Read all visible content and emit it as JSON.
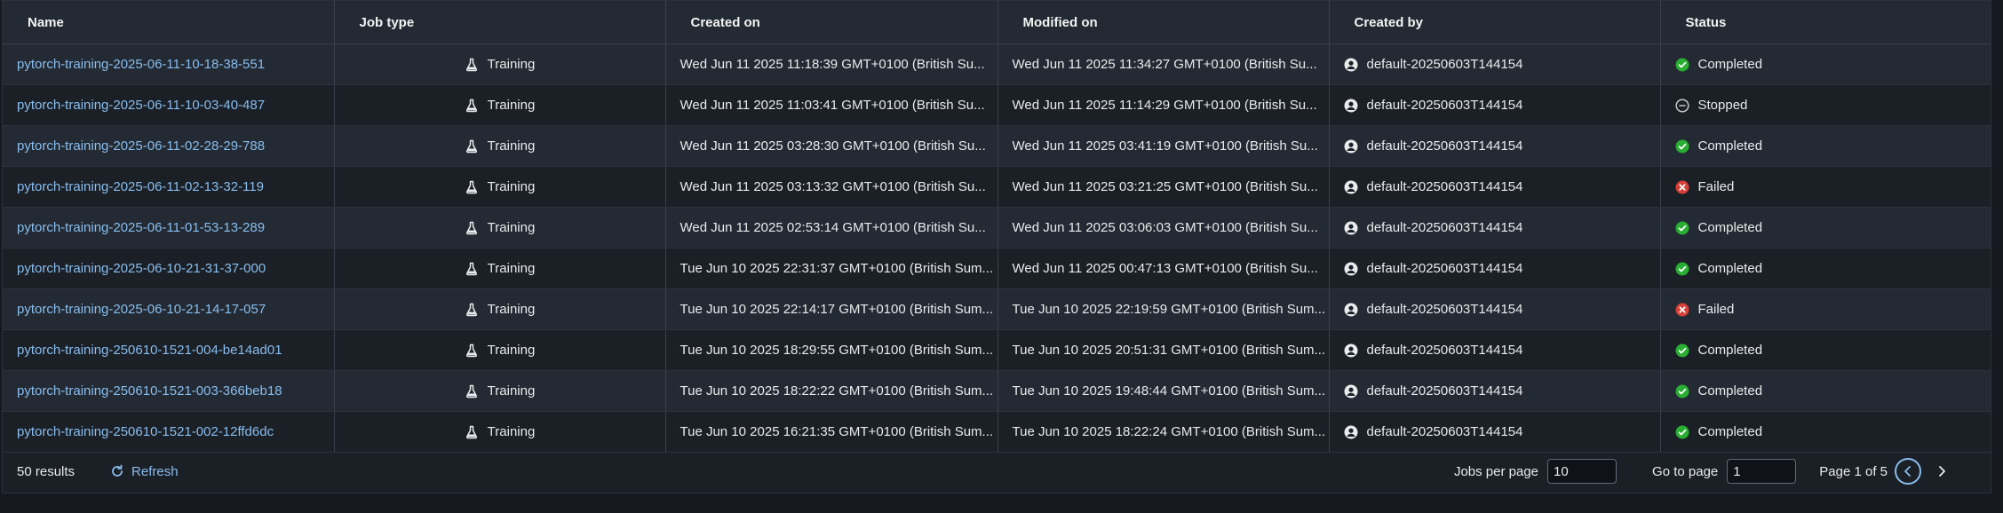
{
  "columns": [
    "Name",
    "Job type",
    "Created on",
    "Modified on",
    "Created by",
    "Status"
  ],
  "rows": [
    {
      "name": "pytorch-training-2025-06-11-10-18-38-551",
      "type": "Training",
      "created": "Wed Jun 11 2025 11:18:39 GMT+0100 (British Su...",
      "modified": "Wed Jun 11 2025 11:34:27 GMT+0100 (British Su...",
      "by": "default-20250603T144154",
      "status": "Completed",
      "status_icon": "completed-icon"
    },
    {
      "name": "pytorch-training-2025-06-11-10-03-40-487",
      "type": "Training",
      "created": "Wed Jun 11 2025 11:03:41 GMT+0100 (British Su...",
      "modified": "Wed Jun 11 2025 11:14:29 GMT+0100 (British Su...",
      "by": "default-20250603T144154",
      "status": "Stopped",
      "status_icon": "stopped-icon"
    },
    {
      "name": "pytorch-training-2025-06-11-02-28-29-788",
      "type": "Training",
      "created": "Wed Jun 11 2025 03:28:30 GMT+0100 (British Su...",
      "modified": "Wed Jun 11 2025 03:41:19 GMT+0100 (British Su...",
      "by": "default-20250603T144154",
      "status": "Completed",
      "status_icon": "completed-icon"
    },
    {
      "name": "pytorch-training-2025-06-11-02-13-32-119",
      "type": "Training",
      "created": "Wed Jun 11 2025 03:13:32 GMT+0100 (British Su...",
      "modified": "Wed Jun 11 2025 03:21:25 GMT+0100 (British Su...",
      "by": "default-20250603T144154",
      "status": "Failed",
      "status_icon": "failed-icon"
    },
    {
      "name": "pytorch-training-2025-06-11-01-53-13-289",
      "type": "Training",
      "created": "Wed Jun 11 2025 02:53:14 GMT+0100 (British Su...",
      "modified": "Wed Jun 11 2025 03:06:03 GMT+0100 (British Su...",
      "by": "default-20250603T144154",
      "status": "Completed",
      "status_icon": "completed-icon"
    },
    {
      "name": "pytorch-training-2025-06-10-21-31-37-000",
      "type": "Training",
      "created": "Tue Jun 10 2025 22:31:37 GMT+0100 (British Sum...",
      "modified": "Wed Jun 11 2025 00:47:13 GMT+0100 (British Su...",
      "by": "default-20250603T144154",
      "status": "Completed",
      "status_icon": "completed-icon"
    },
    {
      "name": "pytorch-training-2025-06-10-21-14-17-057",
      "type": "Training",
      "created": "Tue Jun 10 2025 22:14:17 GMT+0100 (British Sum...",
      "modified": "Tue Jun 10 2025 22:19:59 GMT+0100 (British Sum...",
      "by": "default-20250603T144154",
      "status": "Failed",
      "status_icon": "failed-icon"
    },
    {
      "name": "pytorch-training-250610-1521-004-be14ad01",
      "type": "Training",
      "created": "Tue Jun 10 2025 18:29:55 GMT+0100 (British Sum...",
      "modified": "Tue Jun 10 2025 20:51:31 GMT+0100 (British Sum...",
      "by": "default-20250603T144154",
      "status": "Completed",
      "status_icon": "completed-icon"
    },
    {
      "name": "pytorch-training-250610-1521-003-366beb18",
      "type": "Training",
      "created": "Tue Jun 10 2025 18:22:22 GMT+0100 (British Sum...",
      "modified": "Tue Jun 10 2025 19:48:44 GMT+0100 (British Sum...",
      "by": "default-20250603T144154",
      "status": "Completed",
      "status_icon": "completed-icon"
    },
    {
      "name": "pytorch-training-250610-1521-002-12ffd6dc",
      "type": "Training",
      "created": "Tue Jun 10 2025 16:21:35 GMT+0100 (British Sum...",
      "modified": "Tue Jun 10 2025 18:22:24 GMT+0100 (British Sum...",
      "by": "default-20250603T144154",
      "status": "Completed",
      "status_icon": "completed-icon"
    }
  ],
  "footer": {
    "results": "50 results",
    "refresh": "Refresh",
    "jobs_per_page_label": "Jobs per page",
    "jobs_per_page_value": "10",
    "go_to_page_label": "Go to page",
    "go_to_page_value": "1",
    "page_info": "Page 1 of 5"
  },
  "colors": {
    "link": "#89bdee",
    "completed": "#29ad32",
    "failed": "#d63f38",
    "stopped": "#c6c6cd"
  }
}
